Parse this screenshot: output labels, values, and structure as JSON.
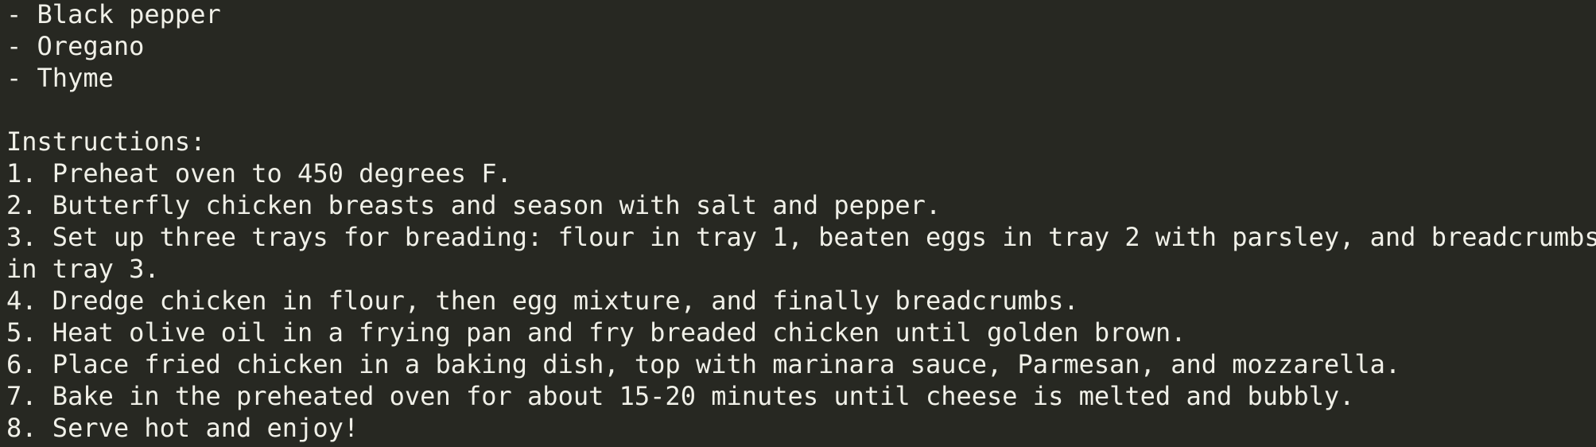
{
  "ingredients_tail": [
    "- Black pepper",
    "- Oregano",
    "- Thyme"
  ],
  "instructions": {
    "heading": "Instructions:",
    "steps": [
      "1. Preheat oven to 450 degrees F.",
      "2. Butterfly chicken breasts and season with salt and pepper.",
      "3. Set up three trays for breading: flour in tray 1, beaten eggs in tray 2 with parsley, and breadcrumbs",
      "in tray 3.",
      "4. Dredge chicken in flour, then egg mixture, and finally breadcrumbs.",
      "5. Heat olive oil in a frying pan and fry breaded chicken until golden brown.",
      "6. Place fried chicken in a baking dish, top with marinara sauce, Parmesan, and mozzarella.",
      "7. Bake in the preheated oven for about 15-20 minutes until cheese is melted and bubbly.",
      "8. Serve hot and enjoy!"
    ]
  },
  "colors": {
    "background": "#272822",
    "text": "#f0f0e8"
  }
}
